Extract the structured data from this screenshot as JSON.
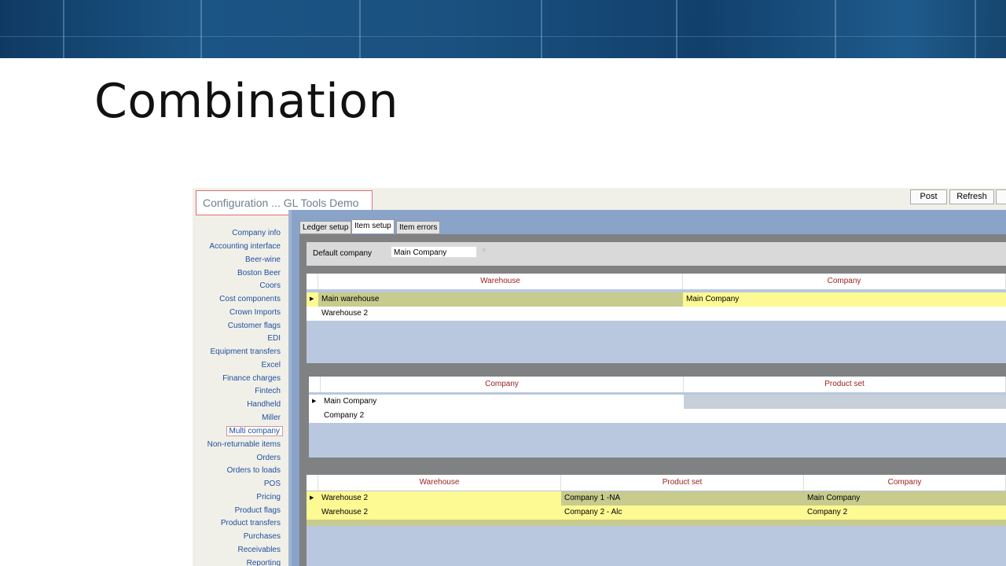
{
  "slide": {
    "title": "Combination"
  },
  "app": {
    "title": "Configuration ... GL Tools Demo",
    "toolbar": {
      "post": "Post",
      "refresh": "Refresh"
    },
    "sidebar": {
      "items": [
        "Company info",
        "Accounting interface",
        "Beer-wine",
        "Boston Beer",
        "Coors",
        "Cost components",
        "Crown Imports",
        "Customer flags",
        "EDI",
        "Equipment transfers",
        "Excel",
        "Finance charges",
        "Fintech",
        "Handheld",
        "Miller",
        "Multi company",
        "Non-returnable items",
        "Orders",
        "Orders to loads",
        "POS",
        "Pricing",
        "Product flags",
        "Product transfers",
        "Purchases",
        "Receivables",
        "Reporting"
      ],
      "selected": "Multi company"
    },
    "tabs": [
      "Ledger setup",
      "Item setup",
      "Item errors"
    ],
    "active_tab": "Item setup",
    "default_company": {
      "label": "Default company",
      "value": "Main Company"
    },
    "grid1": {
      "columns": [
        "Warehouse",
        "Company"
      ],
      "rows": [
        [
          "Main warehouse",
          "Main Company"
        ],
        [
          "Warehouse 2",
          ""
        ]
      ]
    },
    "grid2": {
      "columns": [
        "Company",
        "Product set"
      ],
      "rows": [
        [
          "Main Company",
          ""
        ],
        [
          "Company 2",
          ""
        ]
      ]
    },
    "grid3": {
      "columns": [
        "Warehouse",
        "Product set",
        "Company"
      ],
      "rows": [
        [
          "Warehouse 2",
          "Company 1 -NA",
          "Main Company"
        ],
        [
          "Warehouse 2",
          "Company 2 - Alc",
          "Company 2"
        ]
      ]
    },
    "colors": {
      "selected_row": "#fdf993",
      "focus_cell": "#c7cb8d",
      "header_text": "#9b1c1c",
      "link_text": "#1f4fa0"
    }
  }
}
